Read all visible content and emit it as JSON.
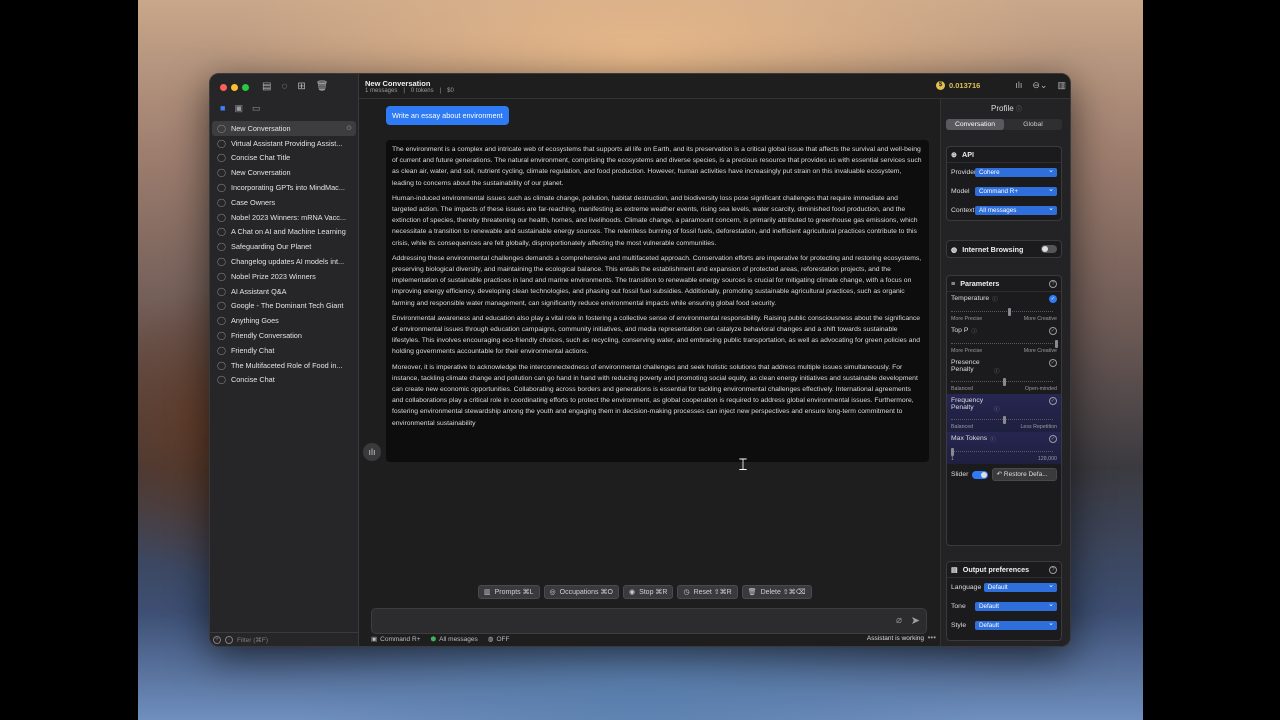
{
  "sidebar": {
    "conversations": [
      "New Conversation",
      "Virtual Assistant Providing Assist...",
      "Concise Chat Title",
      "New Conversation",
      "Incorporating GPTs into MindMac...",
      "Case Owners",
      "Nobel 2023 Winners: mRNA Vacc...",
      "A Chat on AI and Machine Learning",
      "Safeguarding Our Planet",
      "Changelog updates AI models int...",
      "Nobel Prize 2023 Winners",
      "AI Assistant Q&A",
      "Google - The Dominant Tech Giant",
      "Anything Goes",
      "Friendly Conversation",
      "Friendly Chat",
      "The Multifaceted Role of Food in...",
      "Concise Chat"
    ],
    "filter_placeholder": "Filter (⌘F)"
  },
  "header": {
    "title": "New Conversation",
    "messages": "1 messages",
    "tokens": "0 tokens",
    "cost": "$0",
    "credit": "0.013716"
  },
  "chat": {
    "user_message": "Write an essay about environment",
    "assistant_paragraphs": [
      "The environment is a complex and intricate web of ecosystems that supports all life on Earth, and its preservation is a critical global issue that affects the survival and well-being of current and future generations. The natural environment, comprising the ecosystems and diverse species, is a precious resource that provides us with essential services such as clean air, water, and soil, nutrient cycling, climate regulation, and food production. However, human activities have increasingly put strain on this invaluable ecosystem, leading to concerns about the sustainability of our planet.",
      "Human-induced environmental issues such as climate change, pollution, habitat destruction, and biodiversity loss pose significant challenges that require immediate and targeted action. The impacts of these issues are far-reaching, manifesting as extreme weather events, rising sea levels, water scarcity, diminished food production, and the extinction of species, thereby threatening our health, homes, and livelihoods. Climate change, a paramount concern, is primarily attributed to greenhouse gas emissions, which necessitate a transition to renewable and sustainable energy sources. The relentless burning of fossil fuels, deforestation, and inefficient agricultural practices contribute to this crisis, while its consequences are felt globally, disproportionately affecting the most vulnerable communities.",
      "Addressing these environmental challenges demands a comprehensive and multifaceted approach. Conservation efforts are imperative for protecting and restoring ecosystems, preserving biological diversity, and maintaining the ecological balance. This entails the establishment and expansion of protected areas, reforestation projects, and the implementation of sustainable practices in land and marine environments. The transition to renewable energy sources is crucial for mitigating climate change, with a focus on improving energy efficiency, developing clean technologies, and phasing out fossil fuel subsidies. Additionally, promoting sustainable agricultural practices, such as organic farming and responsible water management, can significantly reduce environmental impacts while ensuring global food security.",
      "Environmental awareness and education also play a vital role in fostering a collective sense of environmental responsibility. Raising public consciousness about the significance of environmental issues through education campaigns, community initiatives, and media representation can catalyze behavioral changes and a shift towards sustainable lifestyles. This involves encouraging eco-friendly choices, such as recycling, conserving water, and embracing public transportation, as well as advocating for green policies and holding governments accountable for their environmental actions.",
      "Moreover, it is imperative to acknowledge the interconnectedness of environmental challenges and seek holistic solutions that address multiple issues simultaneously. For instance, tackling climate change and pollution can go hand in hand with reducing poverty and promoting social equity, as clean energy initiatives and sustainable development can create new economic opportunities. Collaborating across borders and generations is essential for tackling environmental challenges effectively. International agreements and collaborations play a critical role in coordinating efforts to protect the environment, as global cooperation is required to address global environmental issues. Furthermore, fostering environmental stewardship among the youth and engaging them in decision-making processes can inject new perspectives and ensure long-term commitment to environmental sustainability"
    ]
  },
  "actions": {
    "prompts": "Prompts ⌘L",
    "occupations": "Occupations ⌘O",
    "stop": "Stop ⌘R",
    "reset": "Reset ⇧⌘R",
    "delete": "Delete ⇧⌘⌫"
  },
  "status": {
    "model": "Command R+",
    "context": "All messages",
    "browsing": "OFF",
    "working": "Assistant is working"
  },
  "panel": {
    "title": "Profile",
    "tabs": [
      "Conversation",
      "Global"
    ],
    "api": {
      "header": "API",
      "provider_label": "Provider",
      "provider": "Cohere",
      "model_label": "Model",
      "model": "Command R+",
      "context_label": "Context",
      "context": "All messages"
    },
    "internet_browsing": "Internet Browsing",
    "parameters": {
      "header": "Parameters",
      "temperature": {
        "label": "Temperature",
        "low": "More Precise",
        "high": "More Creative",
        "level": 0.55
      },
      "top_p": {
        "label": "Top P",
        "low": "More Precise",
        "high": "More Creative",
        "level": 1.0
      },
      "presence": {
        "label": "Presence Penalty",
        "low": "Balanced",
        "high": "Open-minded",
        "level": 0.5
      },
      "frequency": {
        "label": "Frequency Penalty",
        "low": "Balanced",
        "high": "Less Repetition",
        "level": 0.5
      },
      "max_tokens": {
        "label": "Max Tokens",
        "low": "1",
        "high": "128,000",
        "level": 0.0
      },
      "slider_label": "Slider",
      "restore": "Restore Defa..."
    },
    "output": {
      "header": "Output preferences",
      "language_label": "Language",
      "language": "Default",
      "tone_label": "Tone",
      "tone": "Default",
      "style_label": "Style",
      "style": "Default"
    }
  }
}
